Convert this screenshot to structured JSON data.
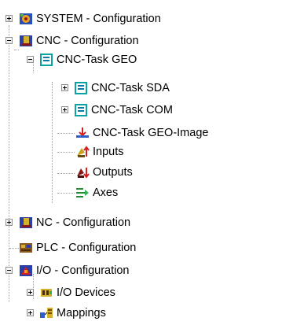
{
  "tree": {
    "system": "SYSTEM - Configuration",
    "cnc": "CNC - Configuration",
    "cnc_task_geo": "CNC-Task GEO",
    "cnc_task_sda": "CNC-Task SDA",
    "cnc_task_com": "CNC-Task COM",
    "cnc_task_geo_image": "CNC-Task GEO-Image",
    "inputs": "Inputs",
    "outputs": "Outputs",
    "axes": "Axes",
    "nc": "NC - Configuration",
    "plc": "PLC - Configuration",
    "io": "I/O - Configuration",
    "io_devices": "I/O Devices",
    "mappings": "Mappings"
  }
}
